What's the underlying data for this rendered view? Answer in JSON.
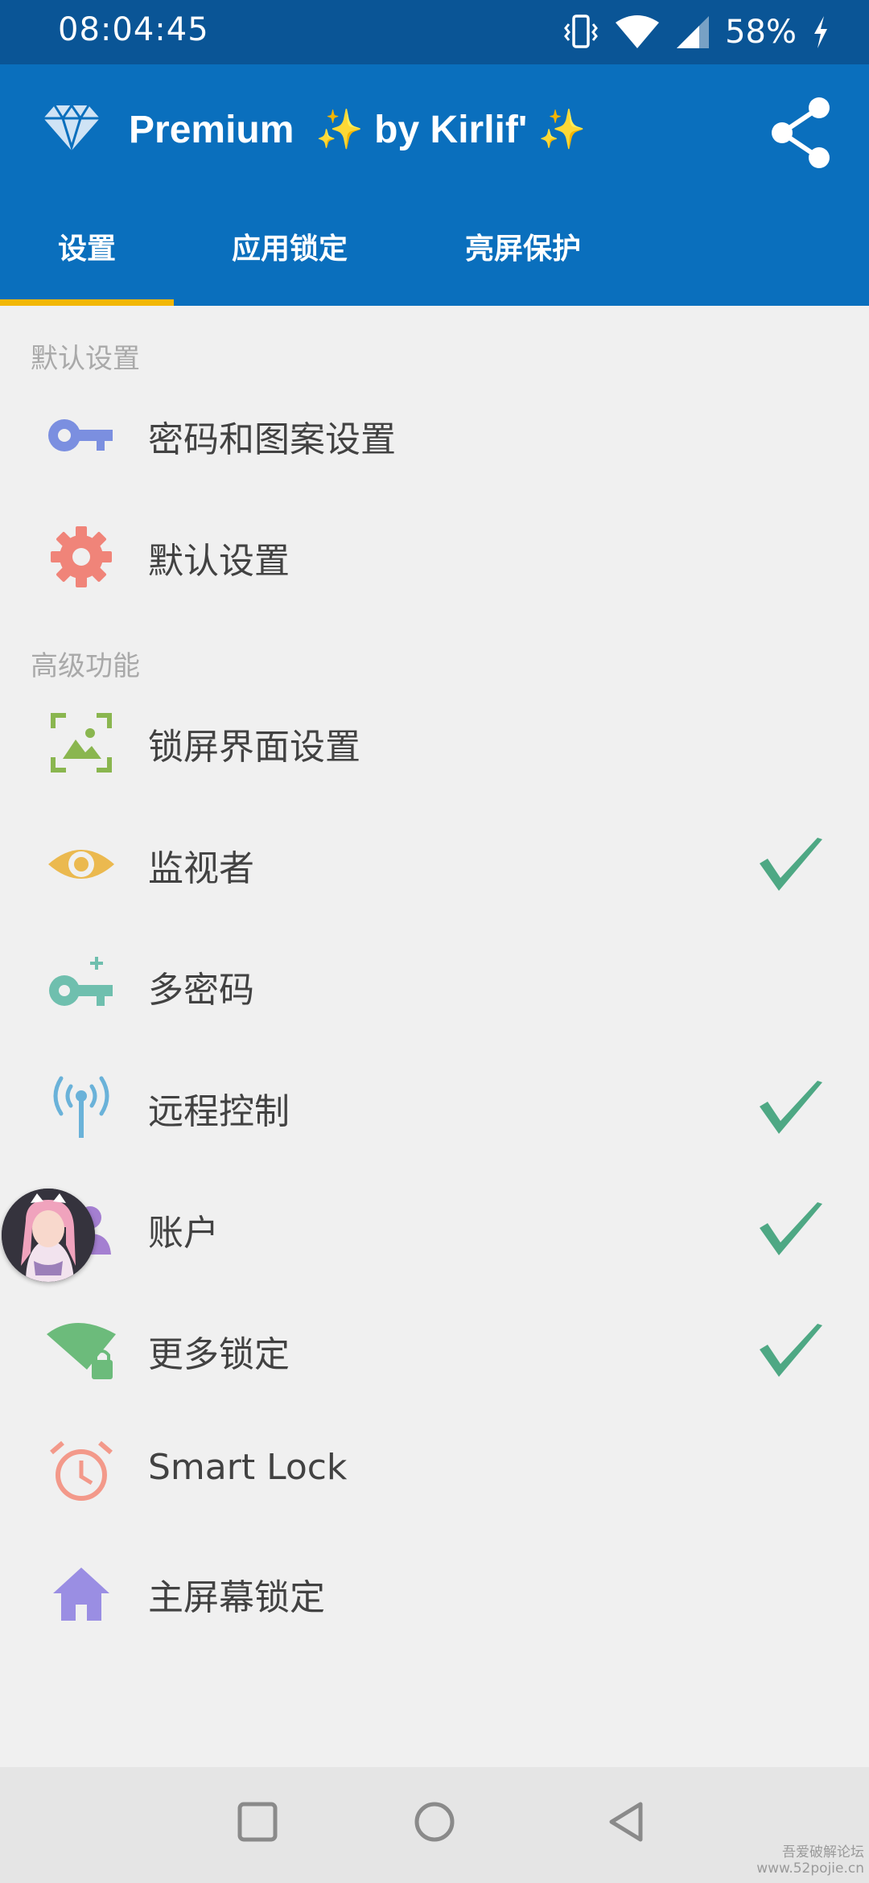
{
  "status_bar": {
    "time": "08:04:45",
    "battery_percent": "58%",
    "icons": [
      "vibrate-icon",
      "wifi-icon",
      "signal-icon",
      "charging-icon"
    ]
  },
  "app_bar": {
    "title": "Premium  ✨ by Kirlif' ✨",
    "tabs": [
      {
        "label": "设置"
      },
      {
        "label": "应用锁定"
      },
      {
        "label": "亮屏保护"
      }
    ],
    "selected_tab": 0
  },
  "sections": [
    {
      "header": "默认设置",
      "items": [
        {
          "label": "密码和图案设置",
          "icon": "key-icon",
          "checked": false
        },
        {
          "label": "默认设置",
          "icon": "gear-icon",
          "checked": false
        }
      ]
    },
    {
      "header": "高级功能",
      "items": [
        {
          "label": "锁屏界面设置",
          "icon": "lockscreen-image-icon",
          "checked": false
        },
        {
          "label": "监视者",
          "icon": "eye-icon",
          "checked": true
        },
        {
          "label": "多密码",
          "icon": "key-plus-icon",
          "checked": false
        },
        {
          "label": "远程控制",
          "icon": "antenna-icon",
          "checked": true
        },
        {
          "label": "账户",
          "icon": "account-icon",
          "checked": true
        },
        {
          "label": "更多锁定",
          "icon": "wifi-lock-icon",
          "checked": true
        },
        {
          "label": "Smart Lock",
          "icon": "alarm-clock-icon",
          "checked": false
        },
        {
          "label": "主屏幕锁定",
          "icon": "home-icon",
          "checked": false
        }
      ]
    }
  ],
  "watermark": {
    "line1": "吾爱破解论坛",
    "line2": "www.52pojie.cn"
  },
  "colors": {
    "status_bar": "#0a5596",
    "app_bar": "#0a6fbd",
    "tab_indicator": "#f2b705",
    "check": "#4ea884",
    "background": "#f0f0f0"
  }
}
